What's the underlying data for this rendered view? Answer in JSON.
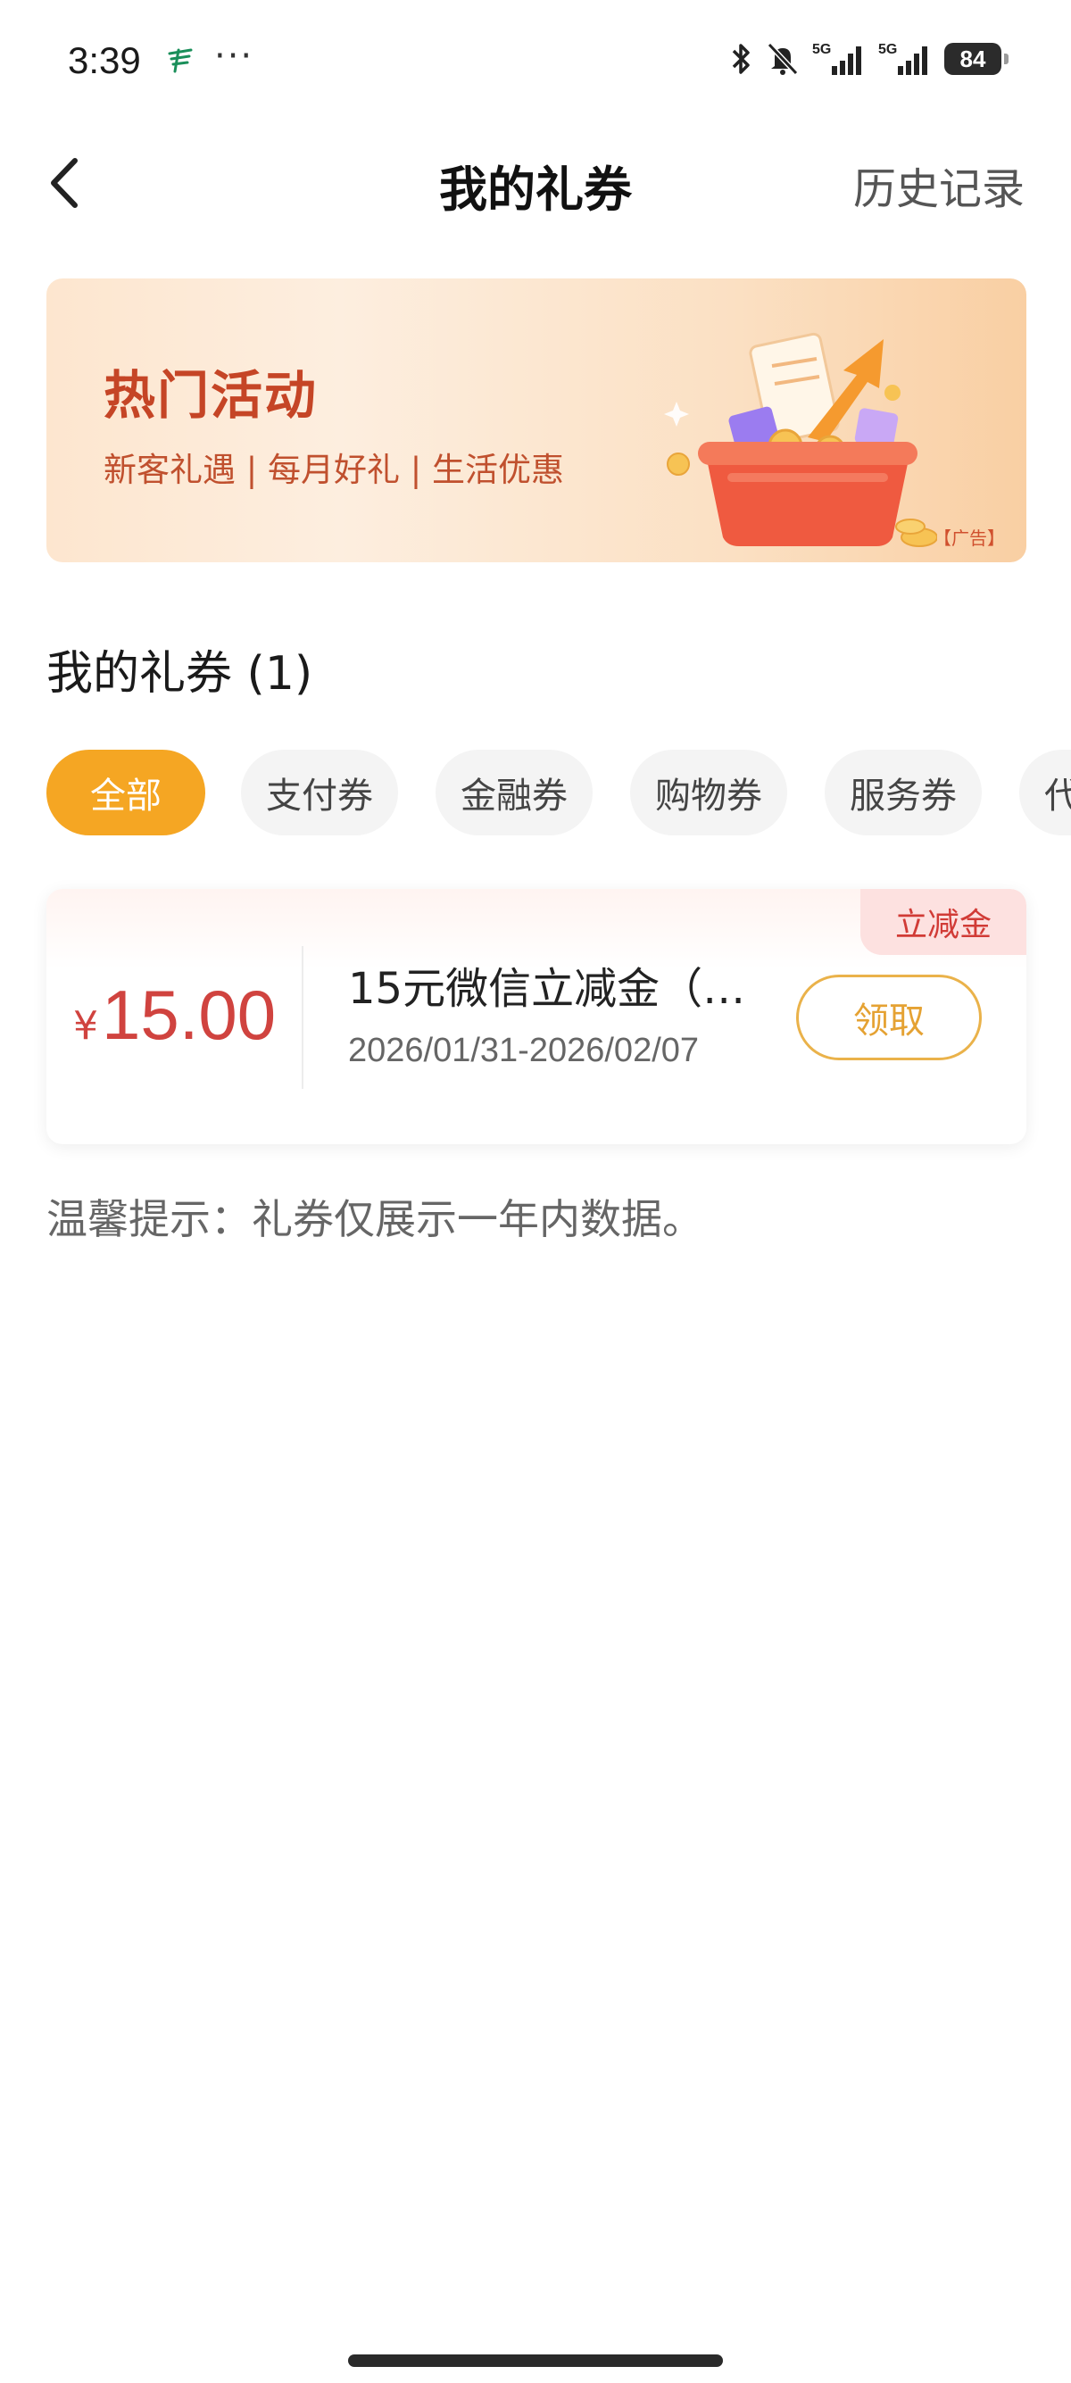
{
  "status_bar": {
    "time": "3:39",
    "more": "···",
    "battery": "84",
    "network_1": "5G",
    "network_2": "5G",
    "icons": [
      "app-notification-icon",
      "bluetooth-icon",
      "mute-icon",
      "signal-icon",
      "battery-icon"
    ]
  },
  "nav": {
    "back_icon": "chevron-left-icon",
    "title": "我的礼券",
    "history": "历史记录"
  },
  "banner": {
    "title": "热门活动",
    "subtitle": "新客礼遇 | 每月好礼 | 生活优惠",
    "ad_label": "【广告】",
    "art_icon": "gift-basket-icon"
  },
  "section": {
    "title": "我的礼券 (1)"
  },
  "tabs": [
    {
      "label": "全部",
      "active": true
    },
    {
      "label": "支付券",
      "active": false
    },
    {
      "label": "金融券",
      "active": false
    },
    {
      "label": "购物券",
      "active": false
    },
    {
      "label": "服务券",
      "active": false
    },
    {
      "label": "代",
      "active": false
    }
  ],
  "coupon": {
    "tag": "立减金",
    "currency": "¥",
    "amount": "15.00",
    "name": "15元微信立减金（…",
    "date_range": "2026/01/31-2026/02/07",
    "button": "领取"
  },
  "tip": "温馨提示：礼券仅展示一年内数据。",
  "colors": {
    "accent": "#f5a623",
    "coupon_red": "#d0433f",
    "banner_red": "#c54526",
    "button_gold": "#e5a233"
  }
}
